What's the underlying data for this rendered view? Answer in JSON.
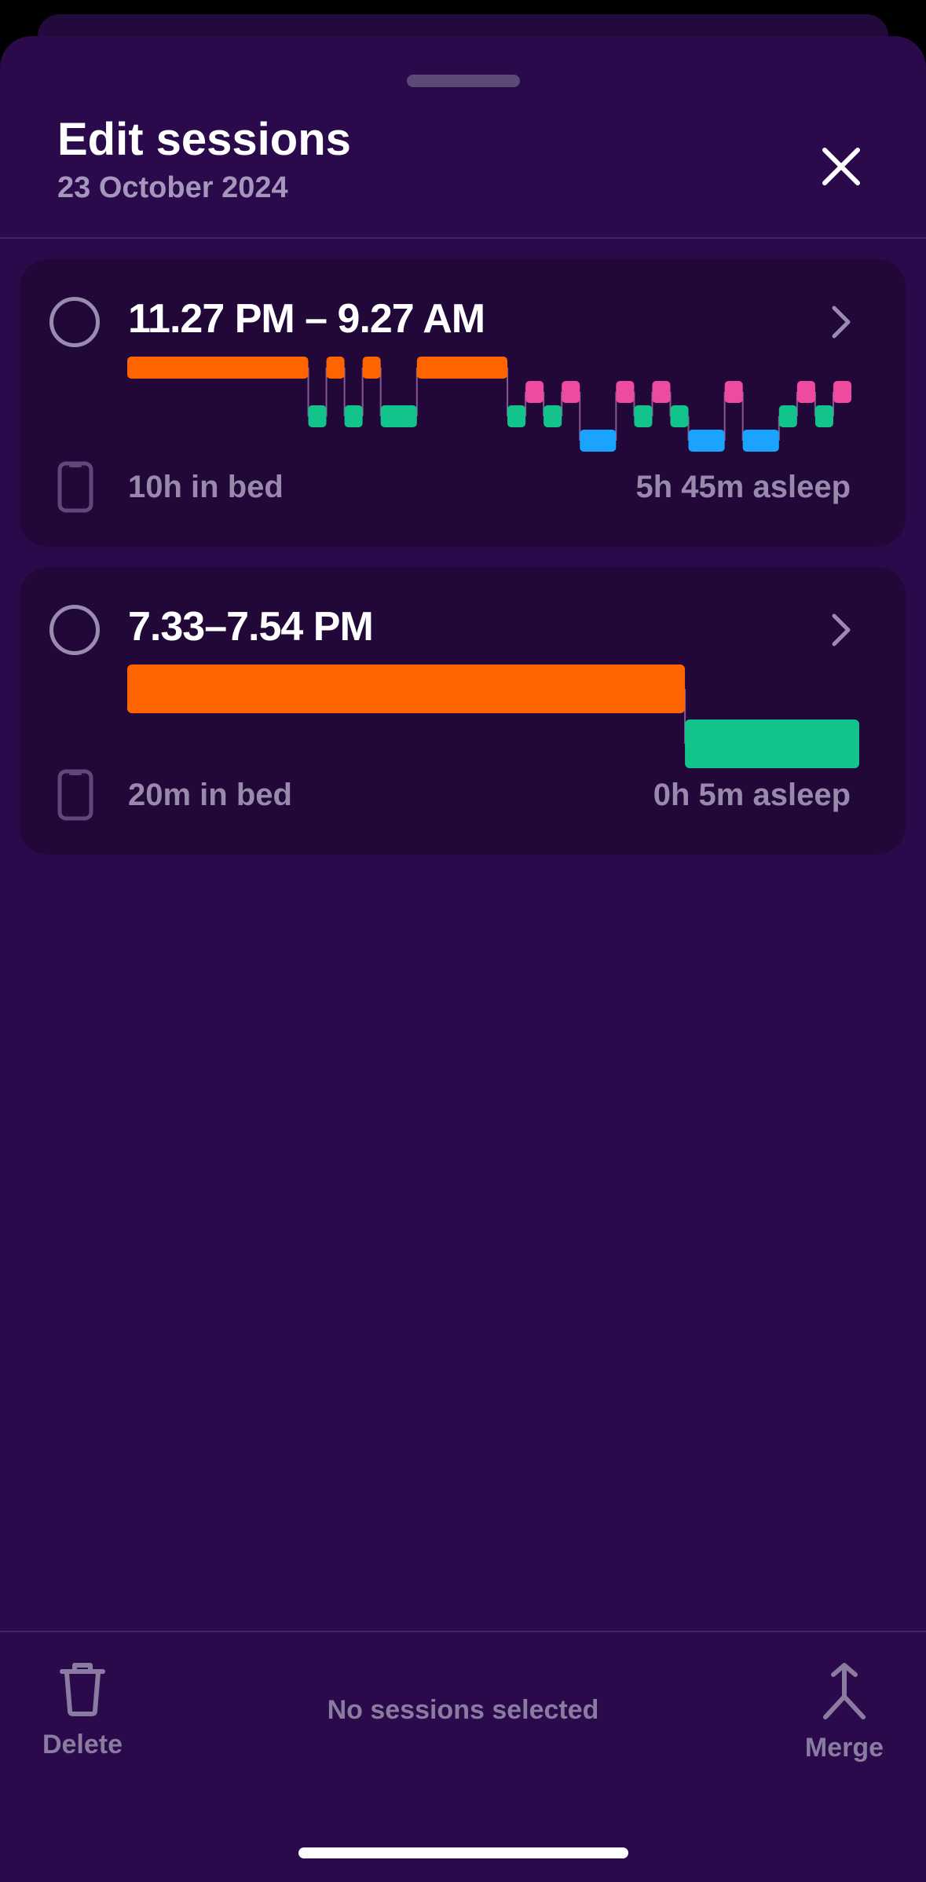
{
  "header": {
    "title": "Edit sessions",
    "date": "23 October 2024",
    "close_icon": "close-icon"
  },
  "colors": {
    "awake": "#ff6400",
    "rem": "#ee4a9f",
    "light": "#12c48c",
    "deep": "#1aa3ff",
    "background": "#2a0a4a",
    "card": "#210838"
  },
  "sessions": [
    {
      "time_range": "11.27 PM – 9.27 AM",
      "in_bed": "10h in bed",
      "asleep": "5h 45m asleep",
      "chart_data": {
        "type": "hypnogram",
        "stage_levels": [
          "awake",
          "rem",
          "light",
          "deep"
        ],
        "total_minutes": 600,
        "segments": [
          {
            "stage": "awake",
            "start": 0,
            "end": 150
          },
          {
            "stage": "light",
            "start": 150,
            "end": 165
          },
          {
            "stage": "awake",
            "start": 165,
            "end": 180
          },
          {
            "stage": "light",
            "start": 180,
            "end": 195
          },
          {
            "stage": "awake",
            "start": 195,
            "end": 210
          },
          {
            "stage": "light",
            "start": 210,
            "end": 240
          },
          {
            "stage": "awake",
            "start": 240,
            "end": 315
          },
          {
            "stage": "light",
            "start": 315,
            "end": 330
          },
          {
            "stage": "rem",
            "start": 330,
            "end": 345
          },
          {
            "stage": "light",
            "start": 345,
            "end": 360
          },
          {
            "stage": "rem",
            "start": 360,
            "end": 375
          },
          {
            "stage": "deep",
            "start": 375,
            "end": 405
          },
          {
            "stage": "rem",
            "start": 405,
            "end": 420
          },
          {
            "stage": "light",
            "start": 420,
            "end": 435
          },
          {
            "stage": "rem",
            "start": 435,
            "end": 450
          },
          {
            "stage": "light",
            "start": 450,
            "end": 465
          },
          {
            "stage": "deep",
            "start": 465,
            "end": 495
          },
          {
            "stage": "rem",
            "start": 495,
            "end": 510
          },
          {
            "stage": "deep",
            "start": 510,
            "end": 540
          },
          {
            "stage": "light",
            "start": 540,
            "end": 555
          },
          {
            "stage": "rem",
            "start": 555,
            "end": 570
          },
          {
            "stage": "light",
            "start": 570,
            "end": 585
          },
          {
            "stage": "rem",
            "start": 585,
            "end": 600
          }
        ]
      }
    },
    {
      "time_range": "7.33–7.54 PM",
      "in_bed": "20m in bed",
      "asleep": "0h 5m asleep",
      "chart_data": {
        "type": "hypnogram",
        "stage_levels": [
          "awake",
          "light"
        ],
        "total_minutes": 21,
        "segments": [
          {
            "stage": "awake",
            "start": 0,
            "end": 16
          },
          {
            "stage": "light",
            "start": 16,
            "end": 21
          }
        ]
      }
    }
  ],
  "footer": {
    "delete_label": "Delete",
    "status": "No sessions selected",
    "merge_label": "Merge"
  }
}
